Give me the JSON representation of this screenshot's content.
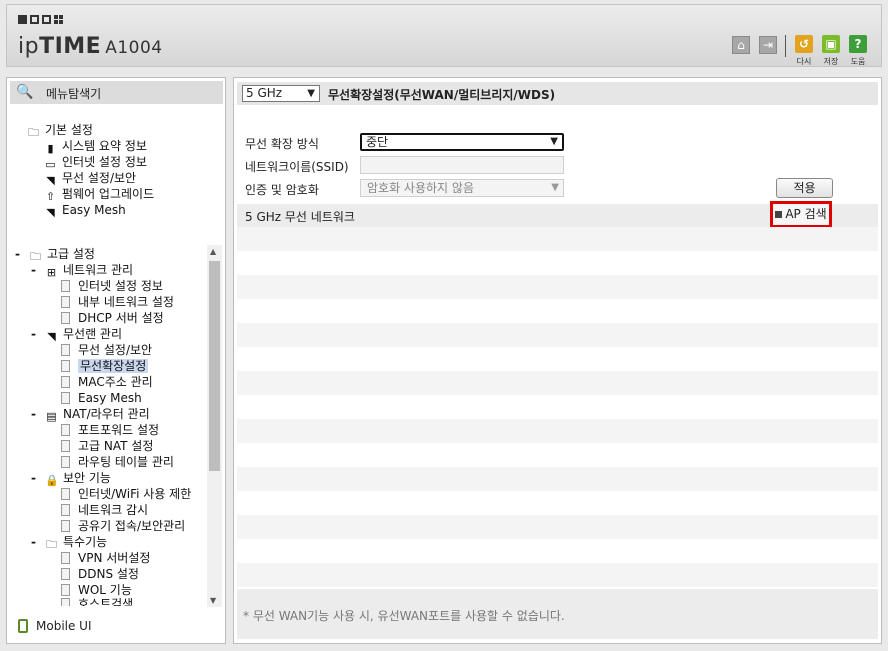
{
  "header": {
    "brand_ip": "ip",
    "brand_time": "TIME",
    "model": "A1004",
    "buttons": {
      "home_icon": "home-icon",
      "logout_icon": "logout-icon",
      "reload_label": "다시",
      "save_label": "저장",
      "help_label": "도움"
    },
    "colors": {
      "reload": "#e3a31c",
      "save": "#7cbc2a",
      "help": "#3e9e3a"
    }
  },
  "sidebar": {
    "title": "메뉴탐색기",
    "basic": {
      "label": "기본 설정",
      "items": [
        "시스템 요약 정보",
        "인터넷 설정 정보",
        "무선 설정/보안",
        "펌웨어 업그레이드",
        "Easy Mesh"
      ]
    },
    "advanced": {
      "label": "고급 설정",
      "groups": [
        {
          "label": "네트워크 관리",
          "items": [
            "인터넷 설정 정보",
            "내부 네트워크 설정",
            "DHCP 서버 설정"
          ]
        },
        {
          "label": "무선랜 관리",
          "items": [
            "무선 설정/보안",
            "무선확장설정",
            "MAC주소 관리",
            "Easy Mesh"
          ]
        },
        {
          "label": "NAT/라우터 관리",
          "items": [
            "포트포워드 설정",
            "고급 NAT 설정",
            "라우팅 테이블 관리"
          ]
        },
        {
          "label": "보안 기능",
          "items": [
            "인터넷/WiFi 사용 제한",
            "네트워크 감시",
            "공유기 접속/보안관리"
          ]
        },
        {
          "label": "특수기능",
          "items": [
            "VPN 서버설정",
            "DDNS 설정",
            "WOL 기능",
            "호스트검색"
          ]
        }
      ]
    },
    "selected_item": "무선확장설정",
    "mobile_label": "Mobile UI"
  },
  "main": {
    "band_value": "5 GHz",
    "title": "무선확장설정(무선WAN/멀티브리지/WDS)",
    "form": {
      "mode_label": "무선 확장 방식",
      "mode_value": "중단",
      "ssid_label": "네트워크이름(SSID)",
      "ssid_value": "",
      "auth_label": "인증 및 암호화",
      "auth_value": "암호화 사용하지 않음",
      "apply_label": "적용"
    },
    "network_section": {
      "label": "5 GHz 무선 네트워크",
      "ap_search_label": "AP 검색"
    },
    "footer_note": "* 무선 WAN기능 사용 시, 유선WAN포트를 사용할 수 없습니다."
  }
}
